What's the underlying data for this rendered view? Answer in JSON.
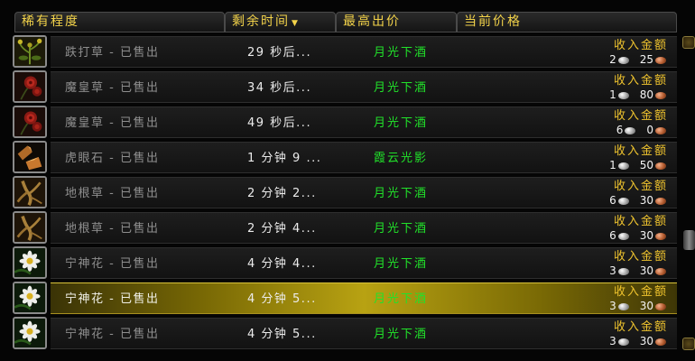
{
  "header": {
    "rarity": "稀有程度",
    "time_left": "剩余时间",
    "top_bid": "最高出价",
    "current_price": "当前价格"
  },
  "sort_icon": "sort-down-arrow",
  "income_label": "收入金额",
  "colors": {
    "header_text": "#f3d34a",
    "bidder": "#21e22a",
    "income": "#f0c42e",
    "selected": "#b8a212"
  },
  "rows": [
    {
      "icon": "kingsblood-herb-icon",
      "name": "跌打草 - 已售出",
      "time": "29 秒后...",
      "bidder": "月光下酒",
      "silver": "2",
      "copper": "25",
      "selected": false
    },
    {
      "icon": "grave-moss-rose-icon",
      "name": "魔皇草 - 已售出",
      "time": "34 秒后...",
      "bidder": "月光下酒",
      "silver": "1",
      "copper": "80",
      "selected": false
    },
    {
      "icon": "grave-moss-rose-icon",
      "name": "魔皇草 - 已售出",
      "time": "49 秒后...",
      "bidder": "月光下酒",
      "silver": "6",
      "copper": "0",
      "selected": false
    },
    {
      "icon": "tigerseye-gem-icon",
      "name": "虎眼石 - 已售出",
      "time": "1 分钟 9 ...",
      "bidder": "霞云光影",
      "silver": "1",
      "copper": "50",
      "selected": false
    },
    {
      "icon": "earthroot-herb-icon",
      "name": "地根草 - 已售出",
      "time": "2 分钟 2...",
      "bidder": "月光下酒",
      "silver": "6",
      "copper": "30",
      "selected": false
    },
    {
      "icon": "earthroot-herb-icon",
      "name": "地根草 - 已售出",
      "time": "2 分钟 4...",
      "bidder": "月光下酒",
      "silver": "6",
      "copper": "30",
      "selected": false
    },
    {
      "icon": "peacebloom-flower-icon",
      "name": "宁神花 - 已售出",
      "time": "4 分钟 4...",
      "bidder": "月光下酒",
      "silver": "3",
      "copper": "30",
      "selected": false
    },
    {
      "icon": "peacebloom-flower-icon",
      "name": "宁神花 - 已售出",
      "time": "4 分钟 5...",
      "bidder": "月光下酒",
      "silver": "3",
      "copper": "30",
      "selected": true
    },
    {
      "icon": "peacebloom-flower-icon",
      "name": "宁神花 - 已售出",
      "time": "4 分钟 5...",
      "bidder": "月光下酒",
      "silver": "3",
      "copper": "30",
      "selected": false
    }
  ]
}
